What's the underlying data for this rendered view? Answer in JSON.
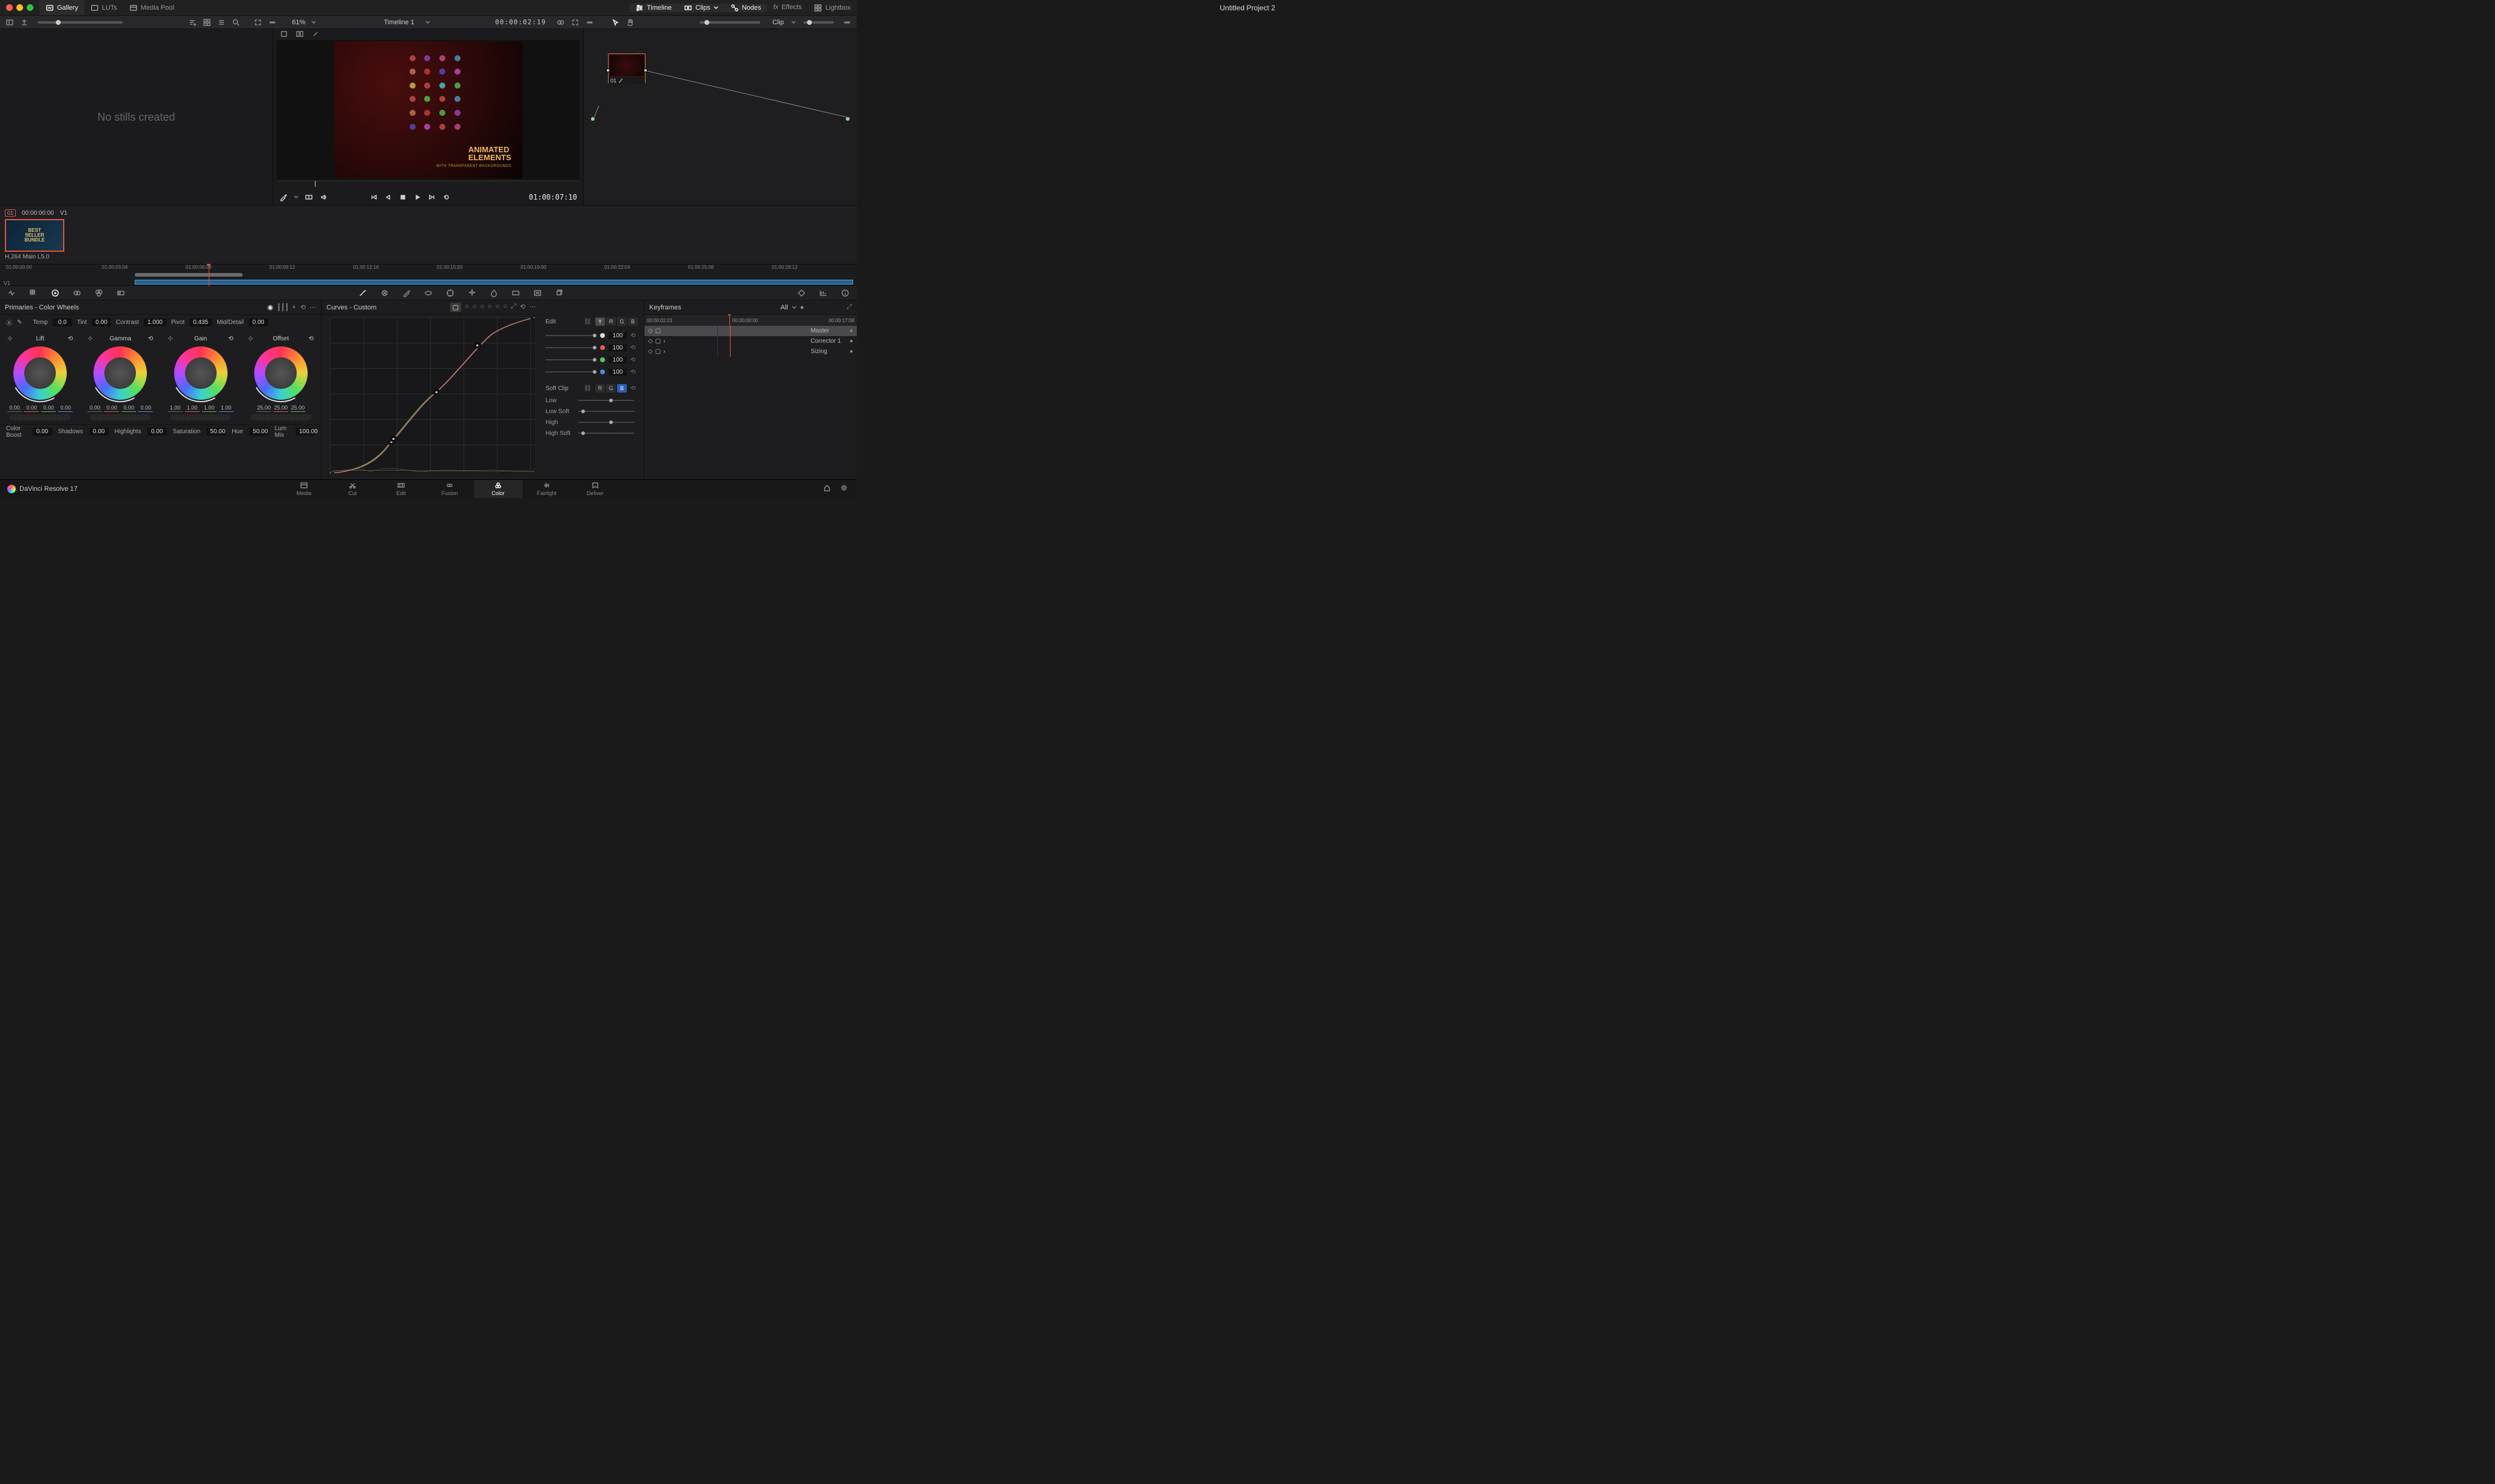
{
  "app": {
    "title": "Untitled Project 2",
    "brand": "DaVinci Resolve 17"
  },
  "topbar": {
    "left": [
      {
        "label": "Gallery",
        "active": true
      },
      {
        "label": "LUTs",
        "active": false
      },
      {
        "label": "Media Pool",
        "active": false
      }
    ],
    "right": [
      {
        "label": "Timeline",
        "active": true
      },
      {
        "label": "Clips",
        "active": true
      },
      {
        "label": "Nodes",
        "active": true
      },
      {
        "label": "Effects",
        "active": false
      },
      {
        "label": "Lightbox",
        "active": false
      }
    ]
  },
  "secondbar": {
    "zoom": "61%",
    "timeline_name": "Timeline 1",
    "timecode": "00:00:02:19",
    "clip_mode": "Clip"
  },
  "gallery": {
    "empty_msg": "No stills created"
  },
  "viewer": {
    "title_line1": "ANIMATED",
    "title_line2": "ELEMENTS",
    "subtitle": "WITH TRANSPARENT BACKGROUNDS",
    "timecode": "01:00:07:10"
  },
  "nodes": {
    "node1_label": "01"
  },
  "clipstrip": {
    "badge": "01",
    "clip_tc": "00:00:00:00",
    "track": "V1",
    "thumb_text": "BEST SELLER BUNDLE",
    "codec": "H.264 Main L5.0"
  },
  "ruler": {
    "ticks": [
      "01:00:00:00",
      "01:00:03:04",
      "01:00:06:08",
      "01:00:09:12",
      "01:00:12:16",
      "01:00:15:20",
      "01:00:19:00",
      "01:00:22:04",
      "01:00:25:08",
      "01:00:28:12"
    ],
    "track_label": "V1"
  },
  "primaries": {
    "title": "Primaries - Color Wheels",
    "temp_label": "Temp",
    "temp": "0.0",
    "tint_label": "Tint",
    "tint": "0.00",
    "contrast_label": "Contrast",
    "contrast": "1.000",
    "pivot_label": "Pivot",
    "pivot": "0.435",
    "middetail_label": "Mid/Detail",
    "middetail": "0.00",
    "wheels": [
      {
        "name": "Lift",
        "vals": [
          "0.00",
          "0.00",
          "0.00",
          "0.00"
        ]
      },
      {
        "name": "Gamma",
        "vals": [
          "0.00",
          "0.00",
          "0.00",
          "0.00"
        ]
      },
      {
        "name": "Gain",
        "vals": [
          "1.00",
          "1.00",
          "1.00",
          "1.00"
        ]
      },
      {
        "name": "Offset",
        "vals": [
          "25.00",
          "25.00",
          "25.00"
        ]
      }
    ],
    "bottom": {
      "colorboost_label": "Color Boost",
      "colorboost": "0.00",
      "shadows_label": "Shadows",
      "shadows": "0.00",
      "highlights_label": "Highlights",
      "highlights": "0.00",
      "saturation_label": "Saturation",
      "saturation": "50.00",
      "hue_label": "Hue",
      "hue": "50.00",
      "lummix_label": "Lum Mix",
      "lummix": "100.00"
    }
  },
  "curves": {
    "title": "Curves - Custom",
    "edit_label": "Edit",
    "channels": [
      {
        "color": "#ddd",
        "val": "100"
      },
      {
        "color": "#e55",
        "val": "100"
      },
      {
        "color": "#5c5",
        "val": "100"
      },
      {
        "color": "#58d",
        "val": "100"
      }
    ],
    "softclip_label": "Soft Clip",
    "softclip_rows": [
      "Low",
      "Low Soft",
      "High",
      "High Soft"
    ]
  },
  "keyframes": {
    "title": "Keyframes",
    "mode": "All",
    "tc_left": "00:00:02:21",
    "tc_mid": "00:00:00:00",
    "tc_right": "00:00:17:08",
    "rows": [
      "Master",
      "Corrector 1",
      "Sizing"
    ]
  },
  "pages": [
    "Media",
    "Cut",
    "Edit",
    "Fusion",
    "Color",
    "Fairlight",
    "Deliver"
  ],
  "active_page": "Color"
}
